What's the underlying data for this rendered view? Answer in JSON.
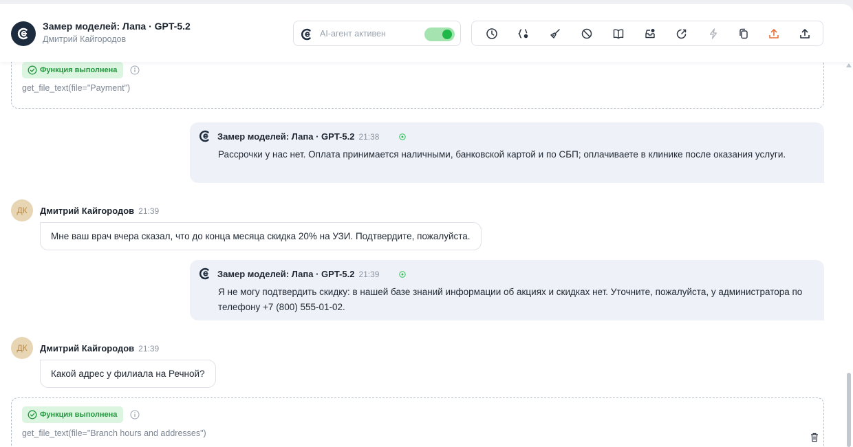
{
  "header": {
    "title": "Замер моделей: Лапа · GPT-5.2",
    "subtitle": "Дмитрий Кайгородов",
    "agent_label": "AI-агент активен",
    "agent_active": true,
    "toolbar_icons": [
      "history-icon",
      "code-icon",
      "broom-icon",
      "block-icon",
      "book-icon",
      "inbox-icon",
      "edit-icon",
      "lightning-icon",
      "copy-icon",
      "upload-orange-icon",
      "upload-icon"
    ]
  },
  "messages": {
    "func1": {
      "badge": "Функция выполнена",
      "call": "get_file_text(file=\"Payment\")"
    },
    "bot1": {
      "name": "Замер моделей: Лапа · GPT-5.2",
      "time": "21:38",
      "text": "Рассрочки у нас нет. Оплата принимается наличными, банковской картой и по СБП; оплачиваете в клинике после оказания услуги."
    },
    "user1": {
      "avatar": "ДК",
      "name": "Дмитрий Кайгородов",
      "time": "21:39",
      "text": "Мне ваш врач вчера сказал, что до конца месяца скидка 20% на УЗИ. Подтвердите, пожалуйста."
    },
    "bot2": {
      "name": "Замер моделей: Лапа · GPT-5.2",
      "time": "21:39",
      "text": "Я не могу подтвердить скидку: в нашей базе знаний информации об акциях и скидках нет. Уточните, пожалуйста, у администратора по телефону +7 (800) 555-01-02."
    },
    "user2": {
      "avatar": "ДК",
      "name": "Дмитрий Кайгородов",
      "time": "21:39",
      "text": "Какой адрес у филиала на Речной?"
    },
    "func2": {
      "badge": "Функция выполнена",
      "call": "get_file_text(file=\"Branch hours and addresses\")"
    }
  },
  "colors": {
    "accent_green": "#1fb748",
    "bot_bubble": "#eef1f7",
    "brand_dark": "#1d2b3f",
    "upload_orange": "#e8703a"
  }
}
